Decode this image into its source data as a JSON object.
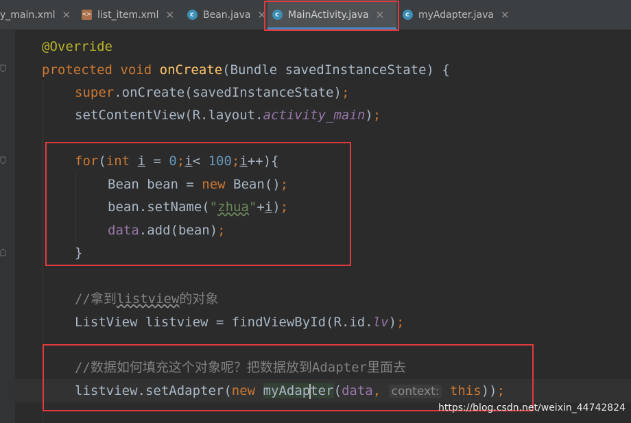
{
  "tabs": [
    {
      "label": "y_main.xml",
      "icon": "xml-file-icon"
    },
    {
      "label": "list_item.xml",
      "icon": "xml-file-icon"
    },
    {
      "label": "Bean.java",
      "icon": "java-class-icon"
    },
    {
      "label": "MainActivity.java",
      "icon": "java-class-icon",
      "active": true
    },
    {
      "label": "myAdapter.java",
      "icon": "java-class-icon"
    }
  ],
  "code": {
    "l1": {
      "ann": "@Override"
    },
    "l2": {
      "kw1": "protected",
      "kw2": "void",
      "fn": "onCreate",
      "rest": "(Bundle savedInstanceState) {"
    },
    "l3": {
      "kw": "super",
      "rest": ".onCreate(savedInstanceState)",
      "semi": ";"
    },
    "l4": {
      "a": "setContentView(R.layout.",
      "field": "activity_main",
      "b": ")",
      "semi": ";"
    },
    "l5": {
      "kw": "for",
      "p1": "(",
      "kw2": "int",
      "v1": "i",
      "eq": " = ",
      "n0": "0",
      "s1": ";",
      "v2": "i",
      "lt": "< ",
      "n100": "100",
      "s2": ";",
      "v3": "i",
      "inc": "++){"
    },
    "l6": {
      "a": "Bean bean = ",
      "kw": "new",
      "b": " Bean()",
      "semi": ";"
    },
    "l7": {
      "a": "bean.setName(",
      "str": "\"zhua\"",
      "b": "+",
      "v": "i",
      "c": ")",
      "semi": ";"
    },
    "l8": {
      "fld": "data",
      "rest": ".add(bean)",
      "semi": ";"
    },
    "l9": {
      "brace": "}"
    },
    "l10": {
      "c1": "//拿到",
      "c2": "listview",
      "c3": "的对象"
    },
    "l11": {
      "a": "ListView listview = findViewById(R.id.",
      "field": "lv",
      "b": ")",
      "semi": ";"
    },
    "l12": {
      "cmt": "//数据如何填充这个对象呢？把数据放到Adapter里面去"
    },
    "l13": {
      "a": "listview.setAdapter(",
      "kw": "new",
      "cls1": "myAdap",
      "cls2": "ter",
      "p": "(",
      "fld": "data",
      "comma": ",",
      "hint": "context:",
      "kw2": "this",
      "end": "))",
      "semi": ";"
    }
  },
  "watermark": "https://blog.csdn.net/weixin_44742824",
  "colors": {
    "background": "#2b2b2b",
    "keyword": "#cc7832",
    "annotation": "#bbb529",
    "method": "#ffc66d",
    "number": "#6897bb",
    "string": "#6a8759",
    "field": "#9876aa",
    "comment": "#808080",
    "highlight_box": "#e03a3e"
  }
}
